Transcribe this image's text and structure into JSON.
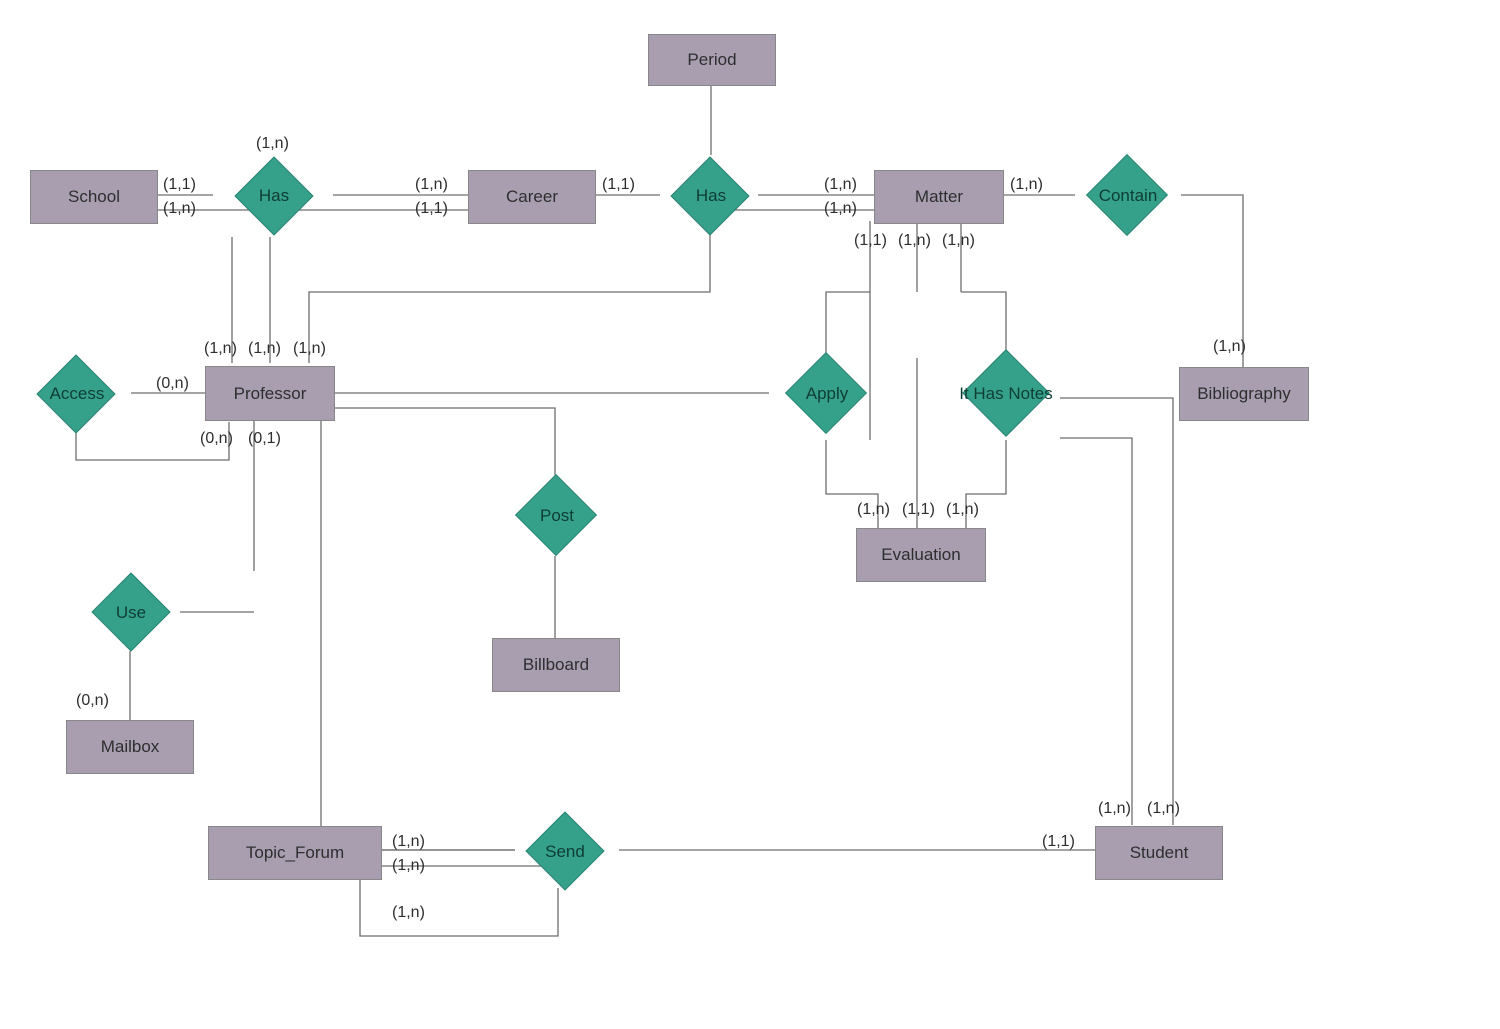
{
  "entities": {
    "school": "School",
    "career": "Career",
    "period": "Period",
    "matter": "Matter",
    "bibliography": "Bibliography",
    "professor": "Professor",
    "evaluation": "Evaluation",
    "billboard": "Billboard",
    "mailbox": "Mailbox",
    "topic_forum": "Topic_Forum",
    "student": "Student"
  },
  "relationships": {
    "has1": "Has",
    "has2": "Has",
    "contain": "Contain",
    "access": "Access",
    "apply": "Apply",
    "it_has_notes": "It Has Notes",
    "post": "Post",
    "use": "Use",
    "send": "Send"
  },
  "cards": {
    "school_has_tl": "(1,1)",
    "school_has_bl": "(1,n)",
    "has1_top": "(1,n)",
    "has1_career_tl": "(1,n)",
    "has1_career_bl": "(1,1)",
    "career_has2": "(1,1)",
    "has2_matter_tl": "(1,n)",
    "has2_matter_bl": "(1,n)",
    "matter_contain": "(1,n)",
    "contain_bib": "(1,n)",
    "matter_apply_l": "(1,1)",
    "matter_apply_r": "(1,n)",
    "matter_notes": "(1,n)",
    "eval_l": "(1,n)",
    "eval_c": "(1,1)",
    "eval_r": "(1,n)",
    "access_prof": "(0,n)",
    "prof_access_b": "(0,n)",
    "prof_use": "(0,1)",
    "prof_has_l": "(1,n)",
    "prof_has_c": "(1,n)",
    "prof_has_r": "(1,n)",
    "use_mailbox": "(0,n)",
    "tf_send_t": "(1,n)",
    "tf_send_b": "(1,n)",
    "send_extra": "(1,n)",
    "send_student": "(1,1)",
    "student_notes_l": "(1,n)",
    "student_notes_r": "(1,n)"
  }
}
